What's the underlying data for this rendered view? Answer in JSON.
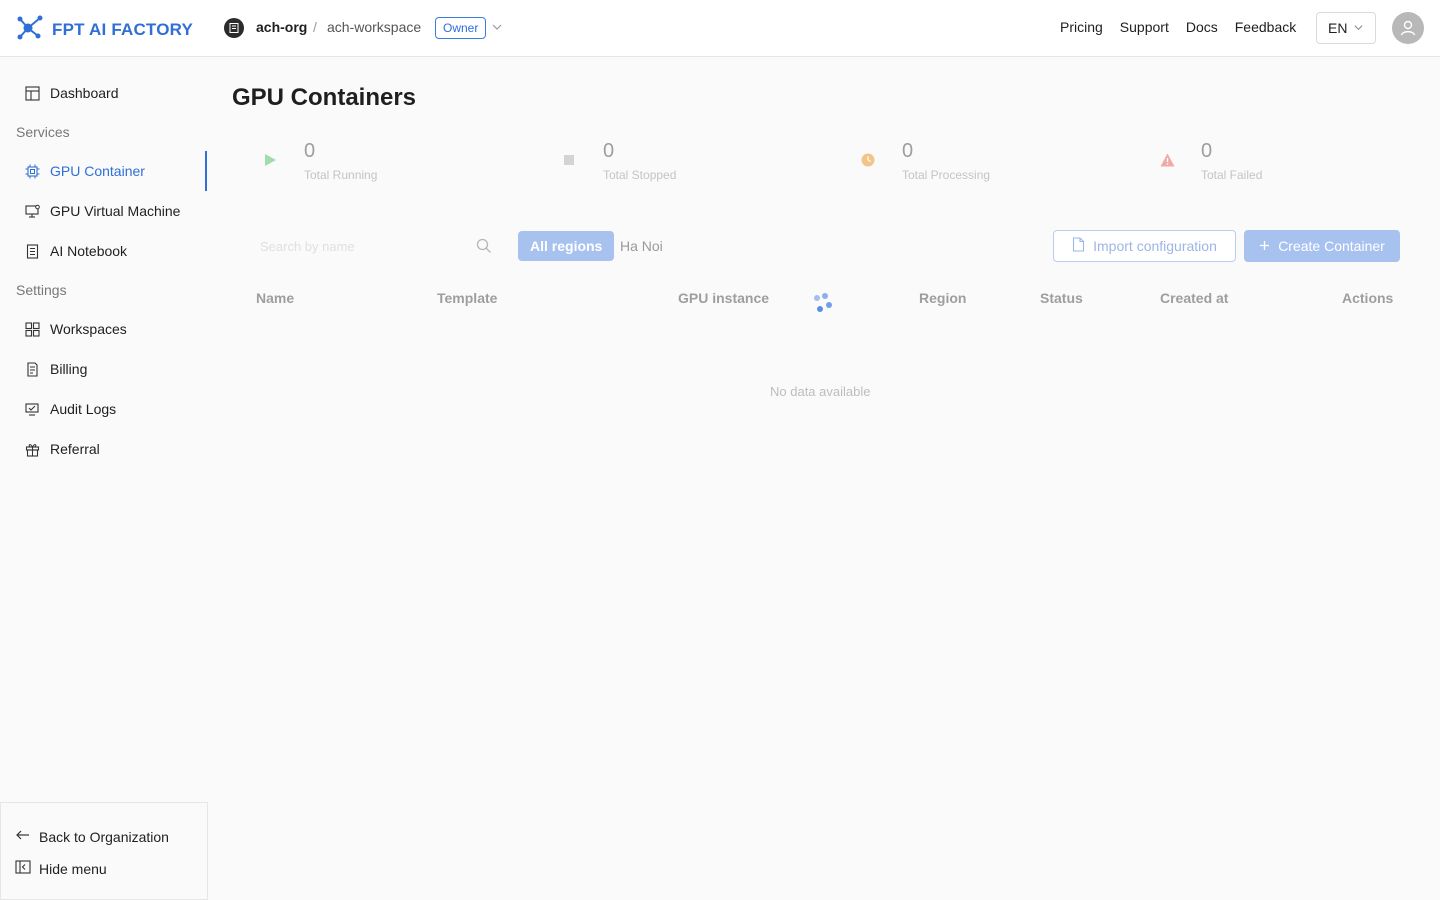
{
  "header": {
    "logo_text": "FPT AI FACTORY",
    "org": "ach-org",
    "separator": "/",
    "workspace": "ach-workspace",
    "role_badge": "Owner",
    "nav": [
      "Pricing",
      "Support",
      "Docs",
      "Feedback"
    ],
    "language": "EN"
  },
  "sidebar": {
    "dashboard": "Dashboard",
    "services_label": "Services",
    "services": [
      "GPU Container",
      "GPU Virtual Machine",
      "AI Notebook"
    ],
    "settings_label": "Settings",
    "settings": [
      "Workspaces",
      "Billing",
      "Audit Logs",
      "Referral"
    ],
    "back_label": "Back to Organization",
    "hide_label": "Hide menu"
  },
  "page": {
    "title": "GPU Containers",
    "stats": [
      {
        "value": "0",
        "label": "Total Running",
        "color": "#9fdcae"
      },
      {
        "value": "0",
        "label": "Total Stopped",
        "color": "#d4d4d4"
      },
      {
        "value": "0",
        "label": "Total Processing",
        "color": "#f2c48a"
      },
      {
        "value": "0",
        "label": "Total Failed",
        "color": "#f0a8a8"
      }
    ],
    "search_placeholder": "Search by name",
    "regions": [
      "All regions",
      "Ha Noi"
    ],
    "import_button": "Import configuration",
    "create_button": "Create Container",
    "columns": [
      "Name",
      "Template",
      "GPU instance",
      "Region",
      "Status",
      "Created at",
      "Actions"
    ],
    "empty_text": "No data available"
  },
  "colors": {
    "accent": "#2f6fd6"
  }
}
